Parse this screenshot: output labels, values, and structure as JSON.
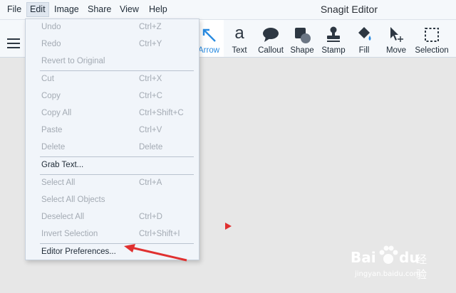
{
  "menubar": {
    "items": [
      {
        "label": "File"
      },
      {
        "label": "Edit"
      },
      {
        "label": "Image"
      },
      {
        "label": "Share"
      },
      {
        "label": "View"
      },
      {
        "label": "Help"
      }
    ]
  },
  "app_title": "Snagit Editor",
  "toolbar": {
    "tools": [
      {
        "label": "Arrow",
        "icon": "arrow-icon",
        "active": true
      },
      {
        "label": "Text",
        "icon": "text-icon"
      },
      {
        "label": "Callout",
        "icon": "callout-icon"
      },
      {
        "label": "Shape",
        "icon": "shape-icon"
      },
      {
        "label": "Stamp",
        "icon": "stamp-icon"
      },
      {
        "label": "Fill",
        "icon": "fill-icon"
      },
      {
        "label": "Move",
        "icon": "move-icon"
      },
      {
        "label": "Selection",
        "icon": "selection-icon"
      }
    ],
    "text_tool_glyph": "a"
  },
  "edit_menu": {
    "items": [
      {
        "label": "Undo",
        "shortcut": "Ctrl+Z",
        "enabled": false
      },
      {
        "label": "Redo",
        "shortcut": "Ctrl+Y",
        "enabled": false
      },
      {
        "label": "Revert to Original",
        "shortcut": "",
        "enabled": false
      },
      {
        "label": "Cut",
        "shortcut": "Ctrl+X",
        "enabled": false
      },
      {
        "label": "Copy",
        "shortcut": "Ctrl+C",
        "enabled": false
      },
      {
        "label": "Copy All",
        "shortcut": "Ctrl+Shift+C",
        "enabled": false
      },
      {
        "label": "Paste",
        "shortcut": "Ctrl+V",
        "enabled": false
      },
      {
        "label": "Delete",
        "shortcut": "Delete",
        "enabled": false
      },
      {
        "label": "Grab Text...",
        "shortcut": "",
        "enabled": true
      },
      {
        "label": "Select All",
        "shortcut": "Ctrl+A",
        "enabled": false
      },
      {
        "label": "Select All Objects",
        "shortcut": "",
        "enabled": false
      },
      {
        "label": "Deselect All",
        "shortcut": "Ctrl+D",
        "enabled": false
      },
      {
        "label": "Invert Selection",
        "shortcut": "Ctrl+Shift+I",
        "enabled": false
      },
      {
        "label": "Editor Preferences...",
        "shortcut": "",
        "enabled": true
      }
    ]
  },
  "watermark": {
    "brand": "Bai",
    "brand_suffix": "du",
    "cn_text": "经验",
    "url": "jingyan.baidu.com"
  },
  "colors": {
    "accent": "#2a8be0",
    "annotation_red": "#e03030"
  }
}
